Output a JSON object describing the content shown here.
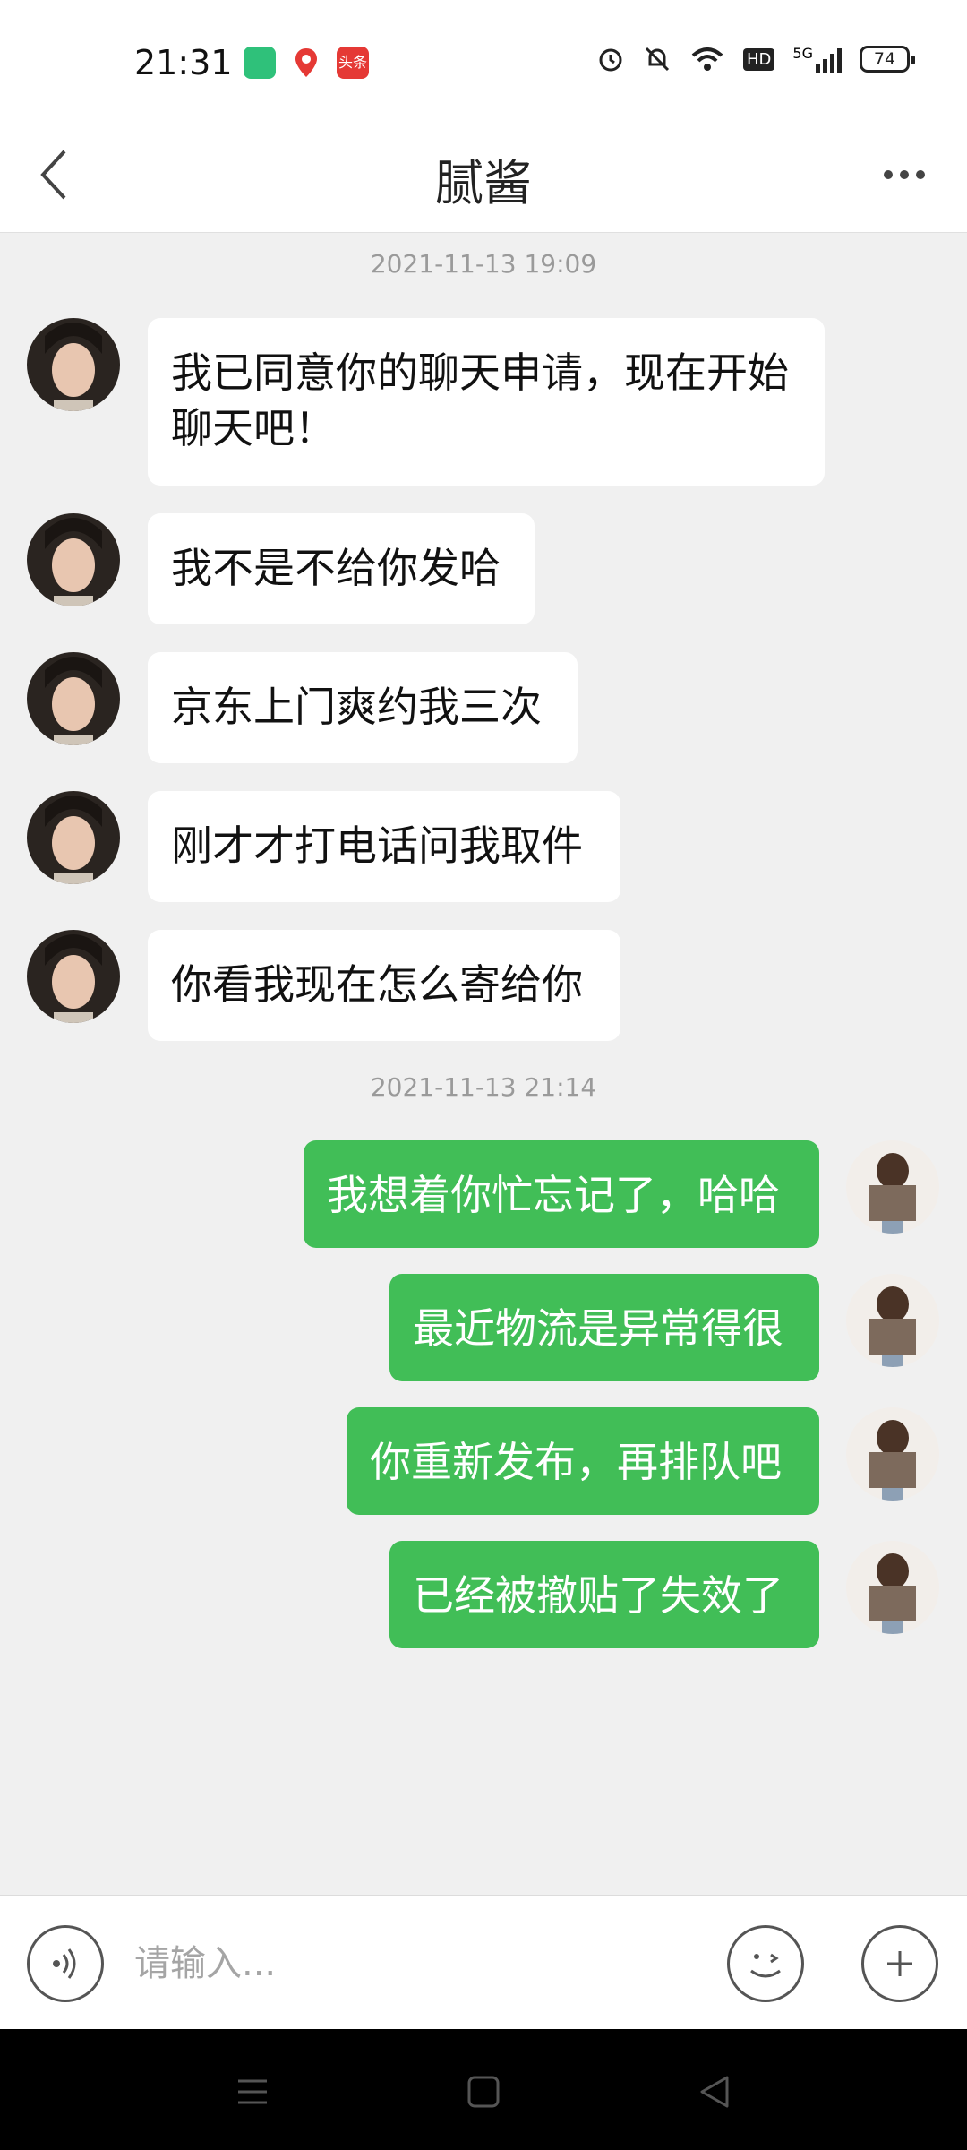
{
  "status_bar": {
    "time": "21:31",
    "network": "5G",
    "battery": "74",
    "hd_label": "HD",
    "news_app_label": "头条"
  },
  "header": {
    "title": "腻酱"
  },
  "timestamps": [
    "2021-11-13 19:09",
    "2021-11-13 21:14"
  ],
  "messages_received": [
    "我已同意你的聊天申请，现在开始聊天吧！",
    "我不是不给你发哈",
    "京东上门爽约我三次",
    "刚才才打电话问我取件",
    "你看我现在怎么寄给你"
  ],
  "messages_sent": [
    "我想着你忙忘记了，哈哈",
    "最近物流是异常得很",
    "你重新发布，再排队吧",
    "已经被撤贴了失效了"
  ],
  "input": {
    "placeholder": "请输入..."
  },
  "icons": {
    "back": "chevron-left-icon",
    "more": "more-dots-icon",
    "voice": "voice-icon",
    "emoji": "emoji-icon",
    "plus": "plus-icon"
  },
  "colors": {
    "sent_bubble": "#41be57",
    "received_bubble": "#ffffff",
    "chat_background": "#f0f0f0"
  }
}
